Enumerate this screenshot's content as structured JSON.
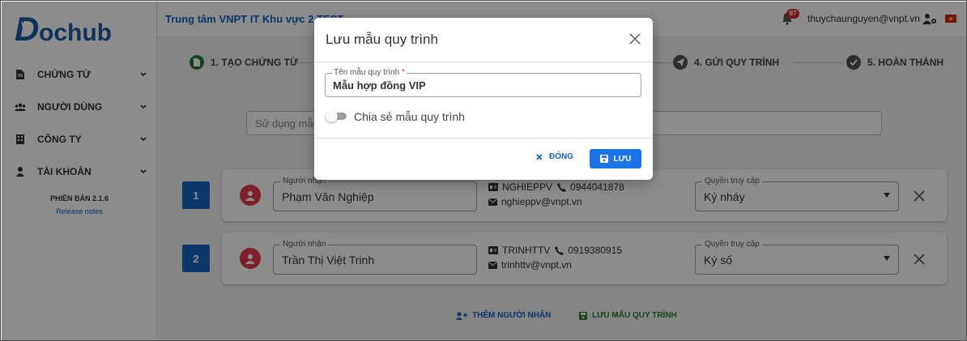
{
  "brand": {
    "logo_text": "ochub",
    "logo_initial": "D"
  },
  "header": {
    "org_name": "Trung tâm VNPT IT Khu vực 2 TEST",
    "notification_count": "97",
    "user_email": "thuychaunguyen@vnpt.vn"
  },
  "sidebar": {
    "items": [
      {
        "label": "CHỨNG TỪ",
        "icon": "document-icon"
      },
      {
        "label": "NGƯỜI DÙNG",
        "icon": "users-icon"
      },
      {
        "label": "CÔNG TY",
        "icon": "building-icon"
      },
      {
        "label": "TÀI KHOẢN",
        "icon": "user-icon"
      }
    ],
    "version": "PHIÊN BẢN 2.1.6",
    "release_notes": "Release notes"
  },
  "stepper": {
    "steps": [
      {
        "label": "1. TẠO CHỨNG TỪ",
        "state": "active"
      },
      {
        "label": "4. GỬI QUY TRÌNH",
        "state": "pending"
      },
      {
        "label": "5. HOÀN THÀNH",
        "state": "pending"
      }
    ]
  },
  "template_search": {
    "placeholder": "Sử dụng mẫu"
  },
  "recipients": [
    {
      "order": "1",
      "legend": "Người nhận",
      "name": "Phạm Văn Nghiệp",
      "username": "NGHIEPPV",
      "phone": "0944041878",
      "email": "nghieppv@vnpt.vn",
      "access_legend": "Quyền truy cập",
      "access": "Ký nháy"
    },
    {
      "order": "2",
      "legend": "Người nhận",
      "name": "Trần Thị Việt Trinh",
      "username": "TRINHTTV",
      "phone": "0919380915",
      "email": "trinhttv@vnpt.vn",
      "access_legend": "Quyền truy cập",
      "access": "Ký số"
    }
  ],
  "actions": {
    "add_recipient": "THÊM NGƯỜI NHẬN",
    "save_template": "LƯU MẪU QUY TRÌNH"
  },
  "modal": {
    "title": "Lưu mẫu quy trình",
    "name_legend": "Tên mẫu quy trình",
    "required_mark": "*",
    "name_value": "Mẫu hợp đồng VIP",
    "share_label": "Chia sẻ mẫu quy trình",
    "share_enabled": false,
    "close_label": "ĐÓNG",
    "save_label": "LƯU"
  },
  "colors": {
    "primary": "#1565c0",
    "save_button": "#1a73e8",
    "success": "#2e7d32",
    "avatar": "#e53950",
    "badge": "#d32f2f"
  }
}
